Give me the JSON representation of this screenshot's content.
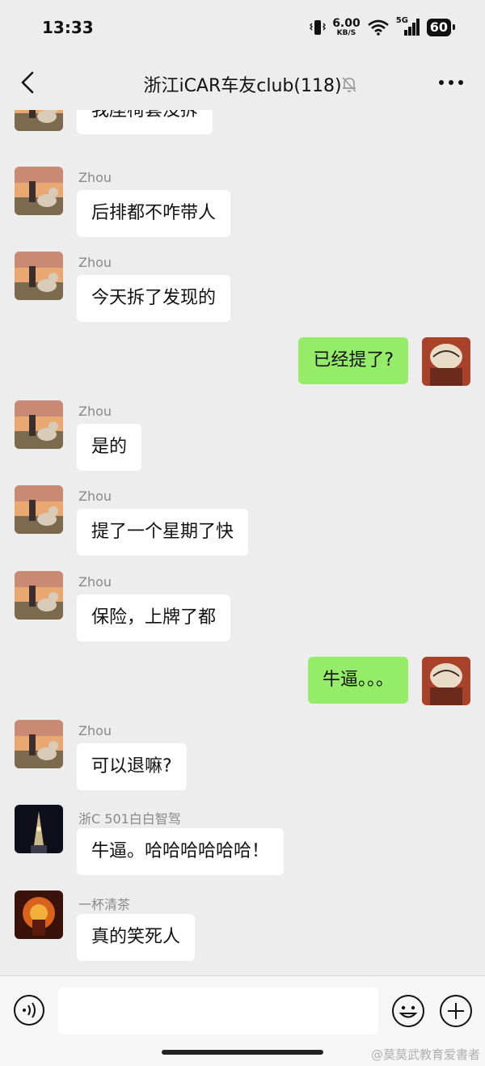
{
  "status": {
    "time": "13:33",
    "speed_value": "6.00",
    "speed_unit": "KB/S",
    "network": "5G",
    "battery": "60"
  },
  "header": {
    "title": "浙江iCAR车友club(118)",
    "back_icon": "chevron-left-icon",
    "mute_icon": "bell-off-icon",
    "more_icon": "more-dots-icon"
  },
  "messages": [
    {
      "side": "left",
      "sender": "",
      "text": "我座椅套没拆",
      "avatar": "boy-dog-sunset"
    },
    {
      "side": "left",
      "sender": "Zhou",
      "text": "后排都不咋带人",
      "avatar": "boy-dog-sunset"
    },
    {
      "side": "left",
      "sender": "Zhou",
      "text": "今天拆了发现的",
      "avatar": "boy-dog-sunset"
    },
    {
      "side": "right",
      "sender": "",
      "text": "已经提了?",
      "avatar": "anime-character"
    },
    {
      "side": "left",
      "sender": "Zhou",
      "text": "是的",
      "avatar": "boy-dog-sunset"
    },
    {
      "side": "left",
      "sender": "Zhou",
      "text": "提了一个星期了快",
      "avatar": "boy-dog-sunset"
    },
    {
      "side": "left",
      "sender": "Zhou",
      "text": "保险，上牌了都",
      "avatar": "boy-dog-sunset"
    },
    {
      "side": "right",
      "sender": "",
      "text": "牛逼。。。",
      "avatar": "anime-character"
    },
    {
      "side": "left",
      "sender": "Zhou",
      "text": "可以退嘛?",
      "avatar": "boy-dog-sunset"
    },
    {
      "side": "left",
      "sender": "浙C 501白白智驾",
      "text": "牛逼。哈哈哈哈哈哈！",
      "avatar": "night-tower"
    },
    {
      "side": "left",
      "sender": "一杯清茶",
      "text": "真的笑死人",
      "avatar": "fire-warrior"
    }
  ],
  "input": {
    "placeholder": "",
    "voice_icon": "voice-icon",
    "emoji_icon": "emoji-icon",
    "plus_icon": "plus-icon"
  },
  "watermark": "@莫莫武教育爱書者",
  "colors": {
    "background": "#ededed",
    "my_bubble": "#95ec69",
    "their_bubble": "#ffffff"
  }
}
